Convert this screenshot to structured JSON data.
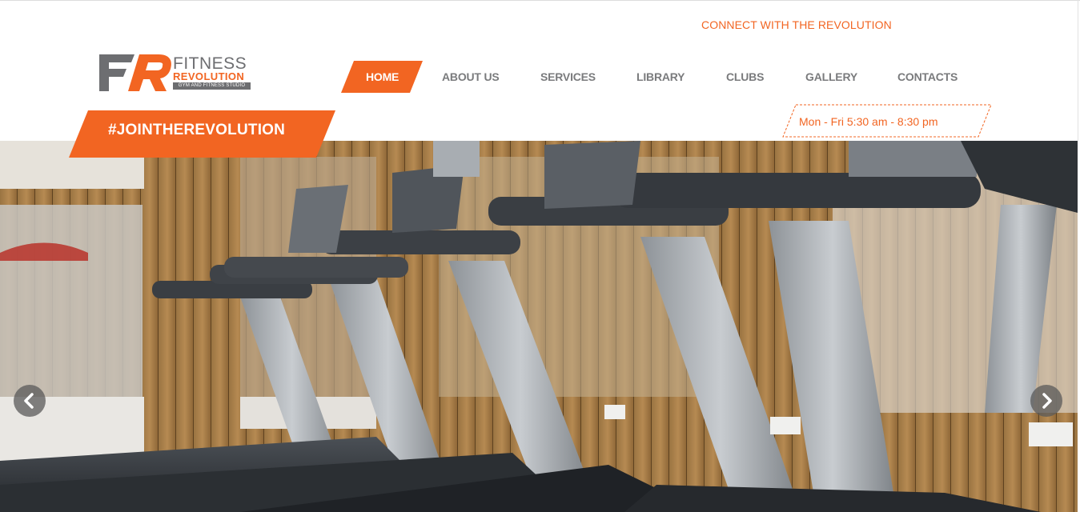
{
  "header": {
    "connect_label": "CONNECT WITH THE REVOLUTION",
    "hashtag_label": "#JOINTHEREVOLUTION",
    "hours_label": "Mon - Fri 5:30 am - 8:30 pm"
  },
  "logo": {
    "mark_text": "FR",
    "word_fitness": "FITNESS",
    "word_revolution": "REVOLUTION",
    "tagline": "GYM AND FITNESS STUDIO",
    "icon": "fr-logo-icon"
  },
  "nav": {
    "items": [
      {
        "label": "HOME",
        "active": true
      },
      {
        "label": "ABOUT US",
        "active": false
      },
      {
        "label": "SERVICES",
        "active": false
      },
      {
        "label": "LIBRARY",
        "active": false
      },
      {
        "label": "CLUBS",
        "active": false
      },
      {
        "label": "GALLERY",
        "active": false
      },
      {
        "label": "CONTACTS",
        "active": false
      }
    ]
  },
  "slider": {
    "prev_icon": "chevron-left-icon",
    "next_icon": "chevron-right-icon",
    "image": "gym-treadmills-photo"
  },
  "colors": {
    "accent": "#f26522",
    "nav_text": "#7a7b7d",
    "logo_gray": "#6d6e71"
  }
}
